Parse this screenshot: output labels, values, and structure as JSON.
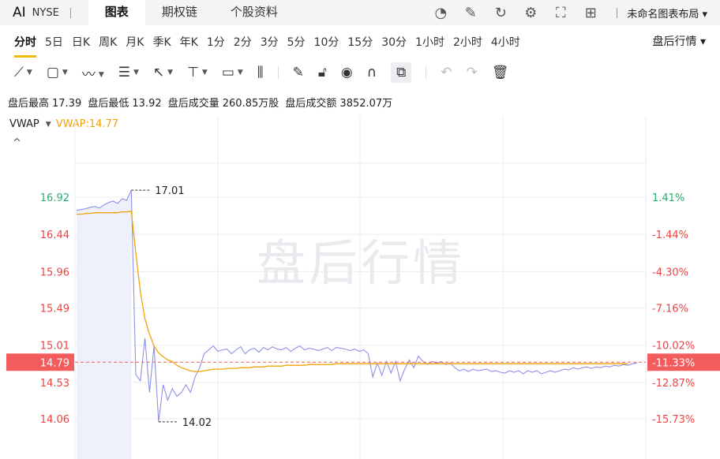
{
  "header": {
    "symbol": "AI",
    "exchange": "NYSE",
    "tabs": [
      {
        "label": "图表",
        "active": true
      },
      {
        "label": "期权链",
        "active": false
      },
      {
        "label": "个股资料",
        "active": false
      }
    ],
    "layout_label": "未命名图表布局"
  },
  "toolbar_icons": [
    "gauge-icon",
    "edit-icon",
    "refresh-icon",
    "settings-icon",
    "fullscreen-icon",
    "grid-layout-icon"
  ],
  "periods": [
    {
      "label": "分时",
      "active": true
    },
    {
      "label": "5日"
    },
    {
      "label": "日K"
    },
    {
      "label": "周K"
    },
    {
      "label": "月K"
    },
    {
      "label": "季K"
    },
    {
      "label": "年K"
    },
    {
      "label": "1分"
    },
    {
      "label": "2分"
    },
    {
      "label": "3分"
    },
    {
      "label": "5分"
    },
    {
      "label": "10分"
    },
    {
      "label": "15分"
    },
    {
      "label": "30分"
    },
    {
      "label": "1小时"
    },
    {
      "label": "2小时"
    },
    {
      "label": "4小时"
    }
  ],
  "session_menu": "盘后行情",
  "stats": {
    "high_label": "盘后最高",
    "high": "17.39",
    "low_label": "盘后最低",
    "low": "13.92",
    "vol_label": "盘后成交量",
    "vol": "260.85万股",
    "amt_label": "盘后成交额",
    "amt": "3852.07万"
  },
  "indicator": {
    "name": "VWAP",
    "value_text": "VWAP:14.77"
  },
  "colors": {
    "price": "#8f91e6",
    "vwap": "#f0a30a",
    "up": "#23b26d",
    "down": "#f04040",
    "current": "#f25c5c"
  },
  "chart_data": {
    "type": "line",
    "watermark": "盘后行情",
    "ylim": [
      13.92,
      17.39
    ],
    "y_ticks": [
      16.92,
      16.44,
      15.96,
      15.49,
      15.01,
      14.53,
      14.06
    ],
    "y_tick_labels": [
      "16.92",
      "16.44",
      "15.96",
      "15.49",
      "15.01",
      "14.53",
      "14.06"
    ],
    "pct_ticks": [
      "1.41%",
      "-1.44%",
      "-4.30%",
      "-7.16%",
      "-10.02%",
      "-12.87%",
      "-15.73%"
    ],
    "current_price": 14.79,
    "current_price_label": "14.79",
    "current_pct_label": "-11.33%",
    "max_marker": {
      "index": 12,
      "value": 17.01,
      "label": "17.01"
    },
    "min_marker": {
      "index": 18,
      "value": 14.02,
      "label": "14.02"
    },
    "series": [
      {
        "values": [
          16.75,
          16.76,
          16.77,
          16.79,
          16.8,
          16.78,
          16.82,
          16.85,
          16.87,
          16.84,
          16.9,
          16.88,
          17.01,
          14.63,
          14.55,
          15.1,
          14.4,
          15.0,
          14.02,
          14.5,
          14.3,
          14.45,
          14.35,
          14.4,
          14.5,
          14.4,
          14.6,
          14.72,
          14.9,
          14.95,
          15.0,
          14.93,
          14.95,
          14.96,
          14.9,
          14.95,
          14.99,
          14.9,
          14.95,
          14.97,
          14.92,
          14.98,
          14.95,
          14.99,
          14.96,
          14.95,
          14.98,
          14.93,
          14.97,
          15.0,
          14.95,
          14.97,
          14.96,
          14.94,
          14.96,
          14.98,
          14.94,
          14.98,
          14.97,
          14.96,
          14.94,
          14.96,
          14.93,
          14.95,
          14.9,
          14.6,
          14.78,
          14.62,
          14.8,
          14.65,
          14.8,
          14.55,
          14.7,
          14.82,
          14.72,
          14.87,
          14.8,
          14.76,
          14.8,
          14.78,
          14.8,
          14.76,
          14.78,
          14.72,
          14.68,
          14.7,
          14.67,
          14.7,
          14.68,
          14.69,
          14.7,
          14.67,
          14.68,
          14.66,
          14.65,
          14.68,
          14.66,
          14.68,
          14.64,
          14.68,
          14.66,
          14.68,
          14.64,
          14.66,
          14.68,
          14.66,
          14.68,
          14.7,
          14.69,
          14.72,
          14.7,
          14.72,
          14.73,
          14.71,
          14.73,
          14.72,
          14.74,
          14.73,
          14.75,
          14.74,
          14.76,
          14.75,
          14.77,
          14.78
        ]
      },
      {
        "name": "VWAP",
        "values": [
          16.7,
          16.7,
          16.71,
          16.71,
          16.72,
          16.72,
          16.72,
          16.72,
          16.72,
          16.72,
          16.73,
          16.73,
          16.74,
          16.2,
          15.7,
          15.35,
          15.15,
          15.0,
          14.91,
          14.86,
          14.82,
          14.8,
          14.75,
          14.72,
          14.7,
          14.68,
          14.67,
          14.67,
          14.68,
          14.69,
          14.7,
          14.7,
          14.7,
          14.71,
          14.71,
          14.71,
          14.72,
          14.72,
          14.72,
          14.73,
          14.73,
          14.73,
          14.74,
          14.74,
          14.74,
          14.74,
          14.75,
          14.75,
          14.75,
          14.75,
          14.75,
          14.76,
          14.76,
          14.76,
          14.76,
          14.76,
          14.76,
          14.77,
          14.77,
          14.77,
          14.77,
          14.77,
          14.77,
          14.77,
          14.77,
          14.77,
          14.77,
          14.77,
          14.77,
          14.77,
          14.77,
          14.77,
          14.77,
          14.77,
          14.77,
          14.77,
          14.77,
          14.77,
          14.77,
          14.77,
          14.77,
          14.77,
          14.77,
          14.77,
          14.77,
          14.77,
          14.77,
          14.77,
          14.77,
          14.77,
          14.77,
          14.77,
          14.77,
          14.77,
          14.77,
          14.77,
          14.77,
          14.77,
          14.77,
          14.77,
          14.77,
          14.77,
          14.77,
          14.77,
          14.77,
          14.77,
          14.77,
          14.77,
          14.77,
          14.77,
          14.77,
          14.77,
          14.77,
          14.77,
          14.77,
          14.77,
          14.77,
          14.77,
          14.77,
          14.77,
          14.77,
          14.77
        ]
      }
    ]
  }
}
